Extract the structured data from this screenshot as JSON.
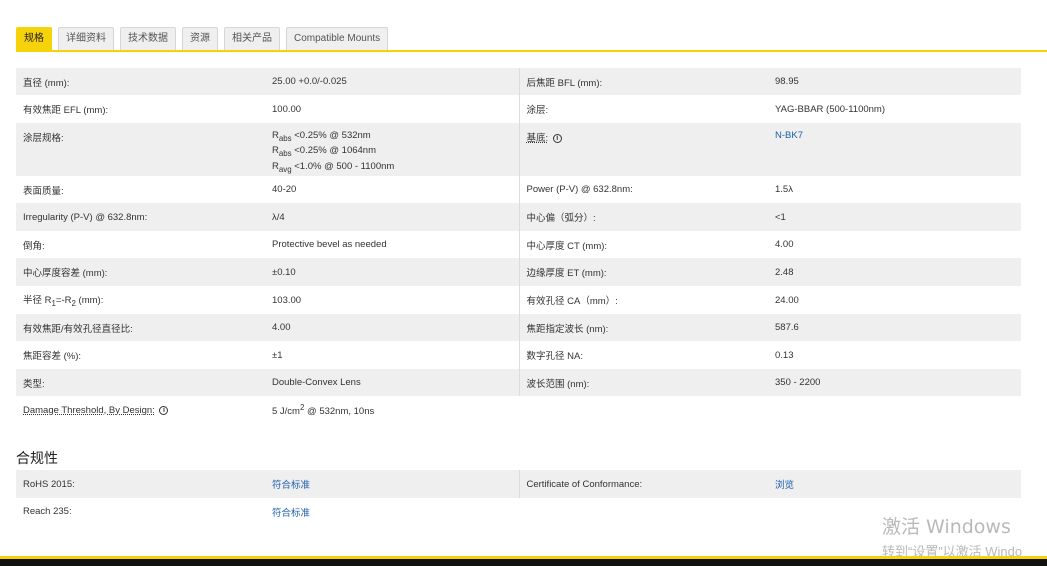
{
  "tabs": [
    {
      "label": "规格",
      "active": true
    },
    {
      "label": "详细资料"
    },
    {
      "label": "技术数据"
    },
    {
      "label": "资源"
    },
    {
      "label": "相关产品"
    },
    {
      "label": "Compatible Mounts"
    }
  ],
  "specs": {
    "diameter": {
      "label": "直径 (mm):",
      "value": "25.00 +0.0/-0.025"
    },
    "bfl": {
      "label": "后焦距 BFL (mm):",
      "value": "98.95"
    },
    "efl": {
      "label": "有效焦距 EFL (mm):",
      "value": "100.00"
    },
    "coating": {
      "label": "涂层:",
      "value": "YAG-BBAR (500-1100nm)"
    },
    "coating_spec": {
      "label": "涂层规格:",
      "lines": [
        {
          "sym": "R",
          "sub": "abs",
          "text": " <0.25% @ 532nm"
        },
        {
          "sym": "R",
          "sub": "abs",
          "text": " <0.25% @ 1064nm"
        },
        {
          "sym": "R",
          "sub": "avg",
          "text": " <1.0% @ 500 - 1100nm"
        }
      ]
    },
    "substrate": {
      "label": "基底:",
      "value": "N-BK7"
    },
    "surface_quality": {
      "label": "表面质量:",
      "value": "40-20"
    },
    "power": {
      "label": "Power (P-V) @ 632.8nm:",
      "value": "1.5λ"
    },
    "irregularity": {
      "label": "Irregularity (P-V) @ 632.8nm:",
      "value": "λ/4"
    },
    "centering": {
      "label": "中心偏（弧分）:",
      "value": "<1"
    },
    "bevel": {
      "label": "倒角:",
      "value": "Protective bevel as needed"
    },
    "ct": {
      "label": "中心厚度 CT (mm):",
      "value": "4.00"
    },
    "ct_tol": {
      "label": "中心厚度容差 (mm):",
      "value": "±0.10"
    },
    "et": {
      "label": "边缘厚度 ET (mm):",
      "value": "2.48"
    },
    "radius": {
      "label_a": "半径 R",
      "sub1": "1",
      "label_b": "=-R",
      "sub2": "2",
      "label_c": " (mm):",
      "value": "103.00"
    },
    "ca": {
      "label": "有效孔径 CA（mm）:",
      "value": "24.00"
    },
    "f_number": {
      "label": "有效焦距/有效孔径直径比:",
      "value": "4.00"
    },
    "design_wavelength": {
      "label": "焦距指定波长 (nm):",
      "value": "587.6"
    },
    "fl_tol": {
      "label": "焦距容差 (%):",
      "value": "±1"
    },
    "na": {
      "label": "数字孔径 NA:",
      "value": "0.13"
    },
    "type": {
      "label": "类型:",
      "value": "Double-Convex Lens"
    },
    "wavelength_range": {
      "label": "波长范围 (nm):",
      "value": "350 - 2200"
    },
    "damage": {
      "label": "Damage Threshold, By Design:",
      "value_a": "5 J/cm",
      "value_sup": "2",
      "value_b": " @ 532nm, 10ns"
    }
  },
  "compliance": {
    "title": "合规性",
    "rohs": {
      "label": "RoHS 2015:",
      "value": "符合标准"
    },
    "coc": {
      "label": "Certificate of Conformance:",
      "value": "浏览"
    },
    "reach": {
      "label": "Reach 235:",
      "value": "符合标准"
    }
  },
  "watermark": {
    "line1": "激活 Windows",
    "line2": "转到“设置”以激活 Windo"
  },
  "colors": {
    "accent": "#f5d20a",
    "link": "#1e5fa8",
    "row_alt": "#efefef"
  },
  "icons": {
    "info": "info-circle-icon"
  }
}
